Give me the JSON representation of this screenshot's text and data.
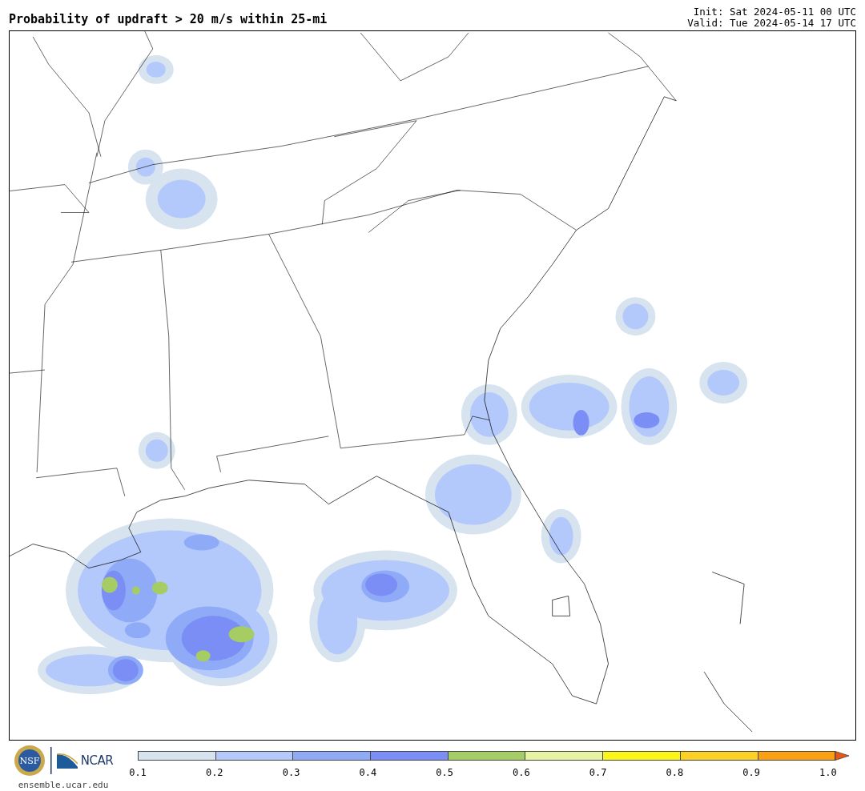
{
  "title": "Probability of updraft > 20 m/s within 25-mi",
  "init": "Init: Sat 2024-05-11 00 UTC",
  "valid": "Valid: Tue 2024-05-14 17 UTC",
  "logos": {
    "nsf": "NSF",
    "ncar": "NCAR",
    "site": "ensemble.ucar.edu"
  },
  "colorbar": {
    "bins": [
      {
        "color": "#d7e3ef"
      },
      {
        "color": "#b3c8fb"
      },
      {
        "color": "#8fabf8"
      },
      {
        "color": "#7a8ef5"
      },
      {
        "color": "#a6cd63"
      },
      {
        "color": "#e5f5a4"
      },
      {
        "color": "#fcf51a"
      },
      {
        "color": "#fcd025"
      },
      {
        "color": "#fba012"
      },
      {
        "kind": "arrow",
        "color": "#ec5510"
      }
    ],
    "ticks": [
      "0.1",
      "0.2",
      "0.3",
      "0.4",
      "0.5",
      "0.6",
      "0.7",
      "0.8",
      "0.9",
      "1.0"
    ]
  }
}
